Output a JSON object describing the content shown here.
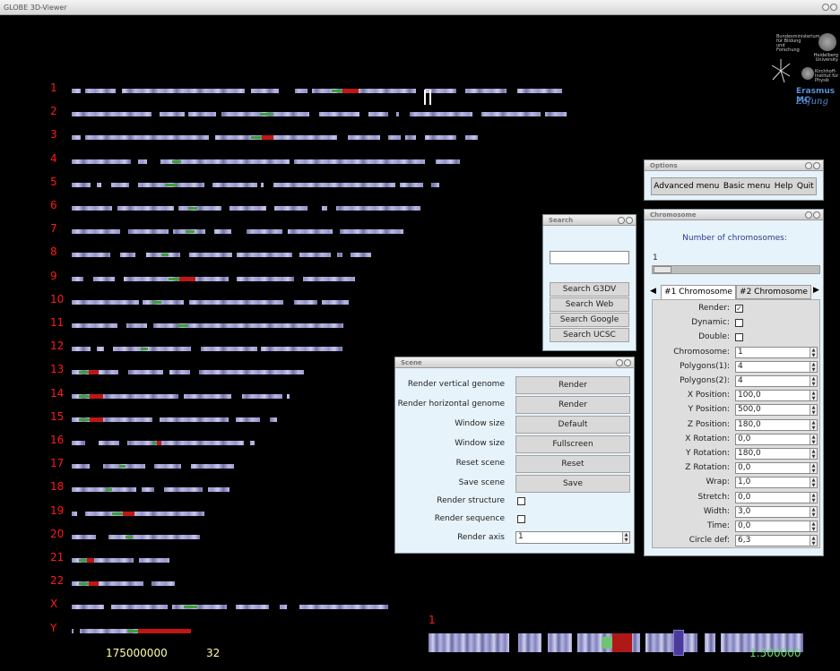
{
  "window": {
    "title": "GLOBE 3D-Viewer"
  },
  "chromosomes": [
    {
      "label": "1",
      "width": 557,
      "cen": [
        290,
        320
      ],
      "red": true
    },
    {
      "label": "2",
      "width": 552,
      "cen": [
        210,
        225
      ],
      "red": false
    },
    {
      "label": "3",
      "width": 453,
      "cen": [
        200,
        225
      ],
      "red": true
    },
    {
      "label": "4",
      "width": 433,
      "cen": [
        112,
        122
      ],
      "red": false
    },
    {
      "label": "5",
      "width": 410,
      "cen": [
        104,
        118
      ],
      "red": false
    },
    {
      "label": "6",
      "width": 389,
      "cen": [
        130,
        140
      ],
      "red": false
    },
    {
      "label": "7",
      "width": 370,
      "cen": [
        127,
        137
      ],
      "red": false
    },
    {
      "label": "8",
      "width": 334,
      "cen": [
        100,
        108
      ],
      "red": false
    },
    {
      "label": "9",
      "width": 316,
      "cen": [
        108,
        138
      ],
      "red": true
    },
    {
      "label": "10",
      "width": 309,
      "cen": [
        90,
        100
      ],
      "red": false
    },
    {
      "label": "11",
      "width": 306,
      "cen": [
        118,
        130
      ],
      "red": false
    },
    {
      "label": "12",
      "width": 302,
      "cen": [
        77,
        85
      ],
      "red": false
    },
    {
      "label": "13",
      "width": 261,
      "cen": [
        8,
        30
      ],
      "red": true
    },
    {
      "label": "14",
      "width": 243,
      "cen": [
        8,
        35
      ],
      "red": true
    },
    {
      "label": "15",
      "width": 229,
      "cen": [
        8,
        35
      ],
      "red": true
    },
    {
      "label": "16",
      "width": 204,
      "cen": [
        90,
        100
      ],
      "red": true
    },
    {
      "label": "17",
      "width": 181,
      "cen": [
        53,
        60
      ],
      "red": false
    },
    {
      "label": "18",
      "width": 176,
      "cen": [
        38,
        45
      ],
      "red": false
    },
    {
      "label": "19",
      "width": 148,
      "cen": [
        45,
        70
      ],
      "red": true
    },
    {
      "label": "20",
      "width": 143,
      "cen": [
        60,
        68
      ],
      "red": false
    },
    {
      "label": "21",
      "width": 109,
      "cen": [
        8,
        25
      ],
      "red": true
    },
    {
      "label": "22",
      "width": 115,
      "cen": [
        8,
        30
      ],
      "red": true
    },
    {
      "label": "X",
      "width": 353,
      "cen": [
        125,
        140
      ],
      "red": false
    },
    {
      "label": "Y",
      "width": 133,
      "cen": [
        62,
        133
      ],
      "red": true
    }
  ],
  "status": {
    "position": "175000000",
    "zoom": "32",
    "selected_chr": "1",
    "scale": "1:500000"
  },
  "options": {
    "title": "Options",
    "buttons": [
      "Advanced menu",
      "Basic menu",
      "Help",
      "Quit"
    ]
  },
  "search": {
    "title": "Search",
    "input_value": "",
    "buttons": [
      "Search G3DV",
      "Search Web",
      "Search Google",
      "Search UCSC"
    ]
  },
  "scene": {
    "title": "Scene",
    "rows": [
      {
        "label": "Render vertical genome",
        "button": "Render"
      },
      {
        "label": "Render horizontal genome",
        "button": "Render"
      },
      {
        "label": "Window size",
        "button": "Default"
      },
      {
        "label": "Window size",
        "button": "Fullscreen"
      },
      {
        "label": "Reset scene",
        "button": "Reset"
      },
      {
        "label": "Save scene",
        "button": "Save"
      }
    ],
    "checks": [
      {
        "label": "Render structure",
        "checked": false
      },
      {
        "label": "Render sequence",
        "checked": false
      }
    ],
    "axis": {
      "label": "Render axis",
      "value": "1"
    }
  },
  "chromosome_panel": {
    "title": "Chromosome",
    "heading": "Number of chromosomes:",
    "count": "1",
    "tabs": [
      "#1 Chromosome",
      "#2 Chromosome"
    ],
    "checks": [
      {
        "label": "Render:",
        "checked": true
      },
      {
        "label": "Dynamic:",
        "checked": false
      },
      {
        "label": "Double:",
        "checked": false
      }
    ],
    "fields": [
      {
        "label": "Chromosome:",
        "value": "1"
      },
      {
        "label": "Polygons(1):",
        "value": "4"
      },
      {
        "label": "Polygons(2):",
        "value": "4"
      },
      {
        "label": "X Position:",
        "value": "100,0"
      },
      {
        "label": "Y Position:",
        "value": "500,0"
      },
      {
        "label": "Z Position:",
        "value": "180,0"
      },
      {
        "label": "X Rotation:",
        "value": "0,0"
      },
      {
        "label": "Y Rotation:",
        "value": "180,0"
      },
      {
        "label": "Z Rotation:",
        "value": "0,0"
      },
      {
        "label": "Wrap:",
        "value": "1,0"
      },
      {
        "label": "Stretch:",
        "value": "0,0"
      },
      {
        "label": "Width:",
        "value": "3,0"
      },
      {
        "label": "Time:",
        "value": "0,0"
      },
      {
        "label": "Circle def:",
        "value": "6,3"
      }
    ]
  },
  "logos": {
    "line1": "Bundesministerium für Bildung und Forschung",
    "line2": "Heidelberg University",
    "line3": "Kirchhoff-Institut für Physik",
    "line4": "Erasmus MC",
    "line5": "Zafung"
  },
  "colors": {
    "chr_label": "#ff1a1a",
    "status_pos": "#ffffaa",
    "status_scale": "#66dd66",
    "centromere": "#c21616"
  }
}
